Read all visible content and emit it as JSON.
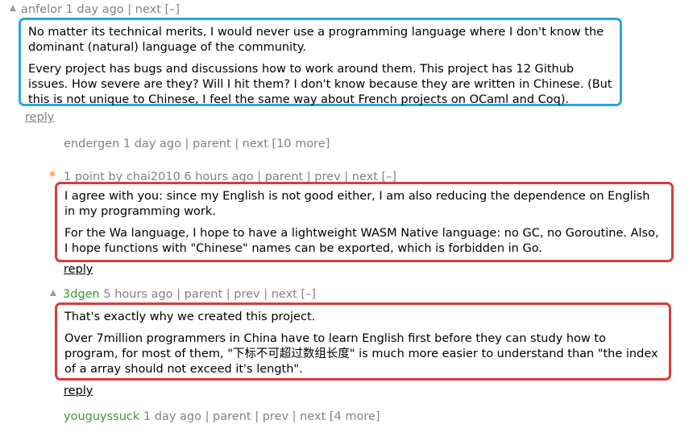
{
  "comments": [
    {
      "user": "anfelor",
      "meta": " 1 day ago | next [–]",
      "paragraphs": [
        "No matter its technical merits, I would never use a programming language where I don't know the dominant (natural) language of the community.",
        "Every project has bugs and discussions how to work around them. This project has 12 Github issues. How severe are they? Will I hit them? I don't know because they are written in Chinese. (But this is not unique to Chinese, I feel the same way about French projects on OCaml and Coq)."
      ],
      "reply": "reply"
    },
    {
      "user": "endergen",
      "meta": " 1 day ago | parent | next [10 more]"
    },
    {
      "star": "*",
      "meta": "1 point by chai2010 6 hours ago | parent | prev | next [–]",
      "paragraphs": [
        "I agree with you: since my English is not good either, I am also reducing the dependence on English in my programming work.",
        "For the Wa language, I hope to have a lightweight WASM Native language: no GC, no Goroutine. Also, I hope functions with \"Chinese\" names can be exported, which is forbidden in Go."
      ],
      "reply": "reply"
    },
    {
      "user": "3dgen",
      "meta": " 5 hours ago | parent | prev | next [–]",
      "paragraphs": [
        "That's exactly why we created this project.",
        "Over 7million programmers in China have to learn English first before they can study how to program, for most of them, \"下标不可超过数组长度\" is much more easier to understand than \"the index of a array should not exceed it's length\"."
      ],
      "reply": "reply"
    },
    {
      "user": "youguyssuck",
      "meta": " 1 day ago | parent | prev | next [4 more]"
    }
  ],
  "colors": {
    "blue_highlight": "#2aa4e8",
    "red_highlight": "#d93b3b",
    "meta_gray": "#828282",
    "new_user_green": "#3c963c",
    "star_orange": "#ff6600"
  }
}
